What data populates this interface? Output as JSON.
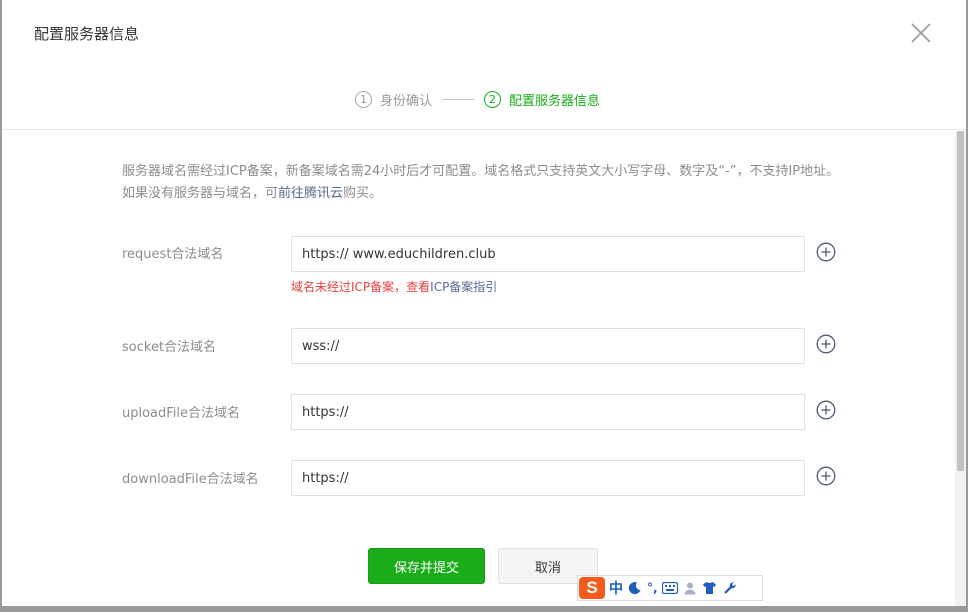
{
  "dialog": {
    "title": "配置服务器信息"
  },
  "steps": [
    {
      "num": "1",
      "label": "身份确认",
      "active": false
    },
    {
      "num": "2",
      "label": "配置服务器信息",
      "active": true
    }
  ],
  "notice": {
    "text_before": "服务器域名需经过ICP备案，新备案域名需24小时后才可配置。域名格式只支持英文大小写字母、数字及“-”，不支持IP地址。如果没有服务器与域名，可",
    "link": "前往腾讯云",
    "text_after": "购买。"
  },
  "fields": {
    "request": {
      "label": "request合法域名",
      "value": "https:// www.educhildren.club"
    },
    "socket": {
      "label": "socket合法域名",
      "value": "wss://"
    },
    "uploadFile": {
      "label": "uploadFile合法域名",
      "value": "https://"
    },
    "downloadFile": {
      "label": "downloadFile合法域名",
      "value": "https://"
    }
  },
  "error": {
    "text": "域名未经过ICP备案，查看",
    "link": "ICP备案指引"
  },
  "buttons": {
    "submit": "保存并提交",
    "cancel": "取消"
  },
  "ime": {
    "logo": "S",
    "mode": "中",
    "punct": "°,"
  },
  "colors": {
    "accent": "#1aad19",
    "error": "#e64340",
    "link": "#576b95"
  }
}
